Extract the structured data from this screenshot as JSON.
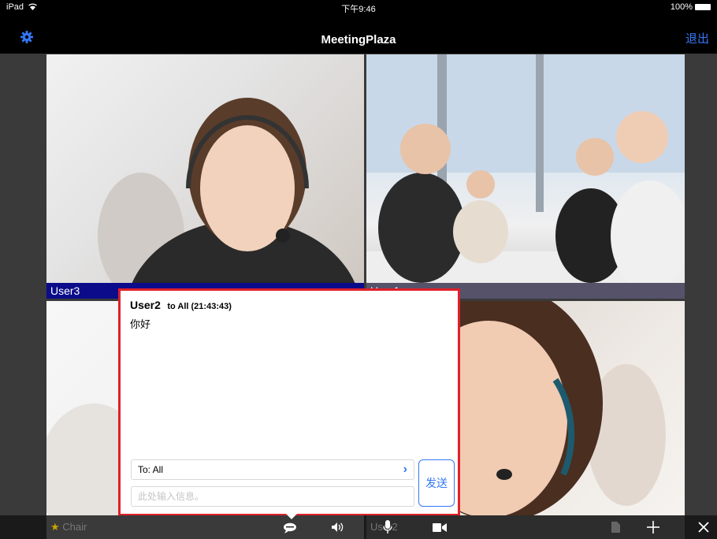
{
  "status_bar": {
    "device": "iPad",
    "time": "下午9:46",
    "battery": "100%"
  },
  "nav": {
    "title": "MeetingPlaza",
    "exit_label": "退出"
  },
  "tiles": [
    {
      "label": "User3"
    },
    {
      "label": "User1"
    }
  ],
  "chat": {
    "sender": "User2",
    "meta": "to All (21:43:43)",
    "message": "你好",
    "to_label": "To: All",
    "input_placeholder": "此处输入信息。",
    "send_label": "发送"
  },
  "toolbar": {
    "chair_label": "Chair",
    "user2_label": "User2"
  },
  "colors": {
    "accent": "#3478f6",
    "chat_border": "#e0202a",
    "label_bg_user3": "#0c0c8a"
  },
  "icons": [
    "wifi-icon",
    "battery-icon",
    "gear-icon",
    "chevron-right-icon",
    "chat-bubble-icon",
    "speaker-icon",
    "microphone-icon",
    "camera-icon",
    "document-icon",
    "plus-icon",
    "close-icon",
    "star-icon"
  ]
}
